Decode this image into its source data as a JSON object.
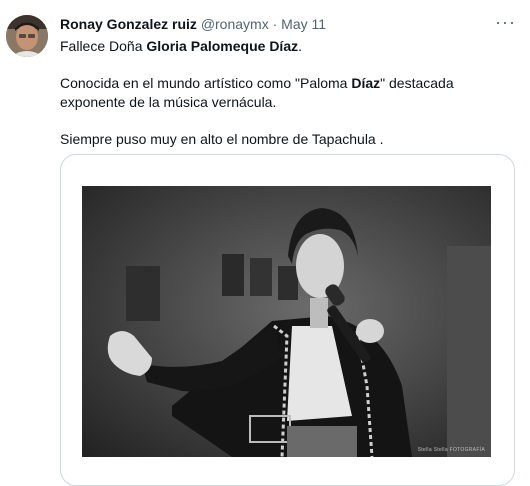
{
  "tweet": {
    "author_name": "Ronay Gonzalez ruiz",
    "author_handle": "@ronaymx",
    "separator": "·",
    "date": "May 11",
    "more_label": "···",
    "line1_prefix": "Fallece Doña ",
    "line1_bold": "Gloria Palomeque Díaz",
    "line1_suffix": ".",
    "line2_part1": "Conocida en el mundo artístico como \"Paloma ",
    "line2_bold": "Díaz",
    "line2_part2": "\"  destacada",
    "line3": "exponente de la música vernácula.",
    "line4": "Siempre puso muy en alto el nombre de Tapachula .",
    "photo_credit": "Stella Stella FOTOGRAFÍA"
  },
  "icons": {
    "avatar": "user-avatar",
    "more": "more-options-icon"
  }
}
